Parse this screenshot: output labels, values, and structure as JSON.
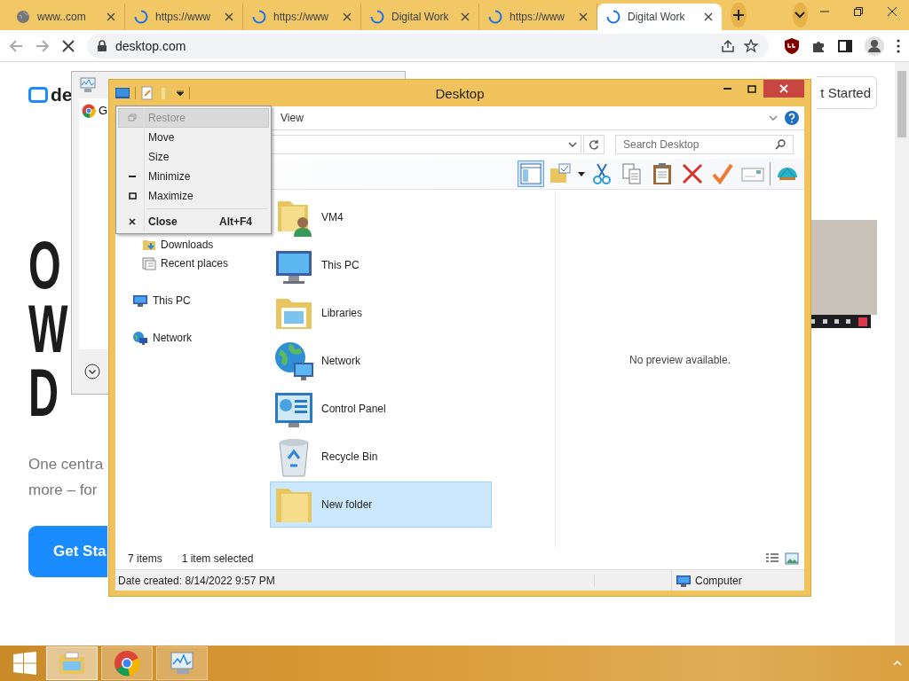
{
  "browser": {
    "tabs": [
      {
        "label": "www..com",
        "kind": "globe",
        "selected": false
      },
      {
        "label": "https://www",
        "kind": "spinner",
        "selected": false
      },
      {
        "label": "https://www",
        "kind": "spinner",
        "selected": false
      },
      {
        "label": "Digital Work",
        "kind": "spinner",
        "selected": false
      },
      {
        "label": "https://www",
        "kind": "spinner",
        "selected": false
      },
      {
        "label": "Digital Work",
        "kind": "spinner",
        "selected": true
      }
    ],
    "address": "desktop.com"
  },
  "page": {
    "logo_text": "de",
    "header_button": "t Started",
    "headline": [
      "O",
      "W",
      "D"
    ],
    "subtitle": [
      "One centra",
      "more – for"
    ],
    "cta": "Get Sta"
  },
  "back_window": {
    "item": "G"
  },
  "explorer": {
    "title": "Desktop",
    "ribbon_tab": "View",
    "search": {
      "placeholder": "Search Desktop"
    },
    "preview_pane_button": {
      "on": true
    },
    "toolbar": [
      {
        "kind": "folder-check"
      },
      {
        "kind": "cut"
      },
      {
        "kind": "copy"
      },
      {
        "kind": "paste"
      },
      {
        "kind": "delete"
      },
      {
        "kind": "check"
      },
      {
        "kind": "rename"
      },
      {
        "kind": "shell"
      }
    ],
    "nav": {
      "group_items": [
        {
          "label": "Downloads",
          "kind": "downloads"
        },
        {
          "label": "Recent places",
          "kind": "recent"
        }
      ],
      "items": [
        {
          "label": "This PC",
          "kind": "pc"
        },
        {
          "label": "Network",
          "kind": "network"
        }
      ]
    },
    "items": [
      {
        "name": "VM4",
        "kind": "user-folder",
        "selected": false
      },
      {
        "name": "This PC",
        "kind": "pc",
        "selected": false
      },
      {
        "name": "Libraries",
        "kind": "libraries",
        "selected": false
      },
      {
        "name": "Network",
        "kind": "network",
        "selected": false
      },
      {
        "name": "Control Panel",
        "kind": "control-panel",
        "selected": false
      },
      {
        "name": "Recycle Bin",
        "kind": "recycle-bin",
        "selected": false
      },
      {
        "name": "New folder",
        "kind": "folder",
        "selected": true
      }
    ],
    "preview": "No preview available.",
    "status": {
      "count": "7 items",
      "selection": "1 item selected"
    },
    "details": {
      "date": "Date created: 8/14/2022 9:57 PM",
      "location": "Computer"
    }
  },
  "system_menu": {
    "items": [
      {
        "kind": "restore",
        "label": "Restore",
        "disabled": true,
        "selected": true,
        "default": false
      },
      {
        "kind": "plain",
        "label": "Move",
        "disabled": false,
        "selected": false,
        "default": false
      },
      {
        "kind": "plain",
        "label": "Size",
        "disabled": false,
        "selected": false,
        "default": false
      },
      {
        "kind": "minimize",
        "label": "Minimize",
        "disabled": false,
        "selected": false,
        "default": false
      },
      {
        "kind": "maximize",
        "label": "Maximize",
        "disabled": false,
        "selected": false,
        "default": false
      },
      {
        "kind": "separator"
      },
      {
        "kind": "close",
        "label": "Close",
        "disabled": false,
        "selected": false,
        "default": true,
        "shortcut": "Alt+F4"
      }
    ]
  },
  "taskbar": {
    "apps": [
      {
        "kind": "explorer",
        "selected": true
      },
      {
        "kind": "chrome",
        "selected": false
      },
      {
        "kind": "task-manager",
        "selected": false
      }
    ]
  }
}
